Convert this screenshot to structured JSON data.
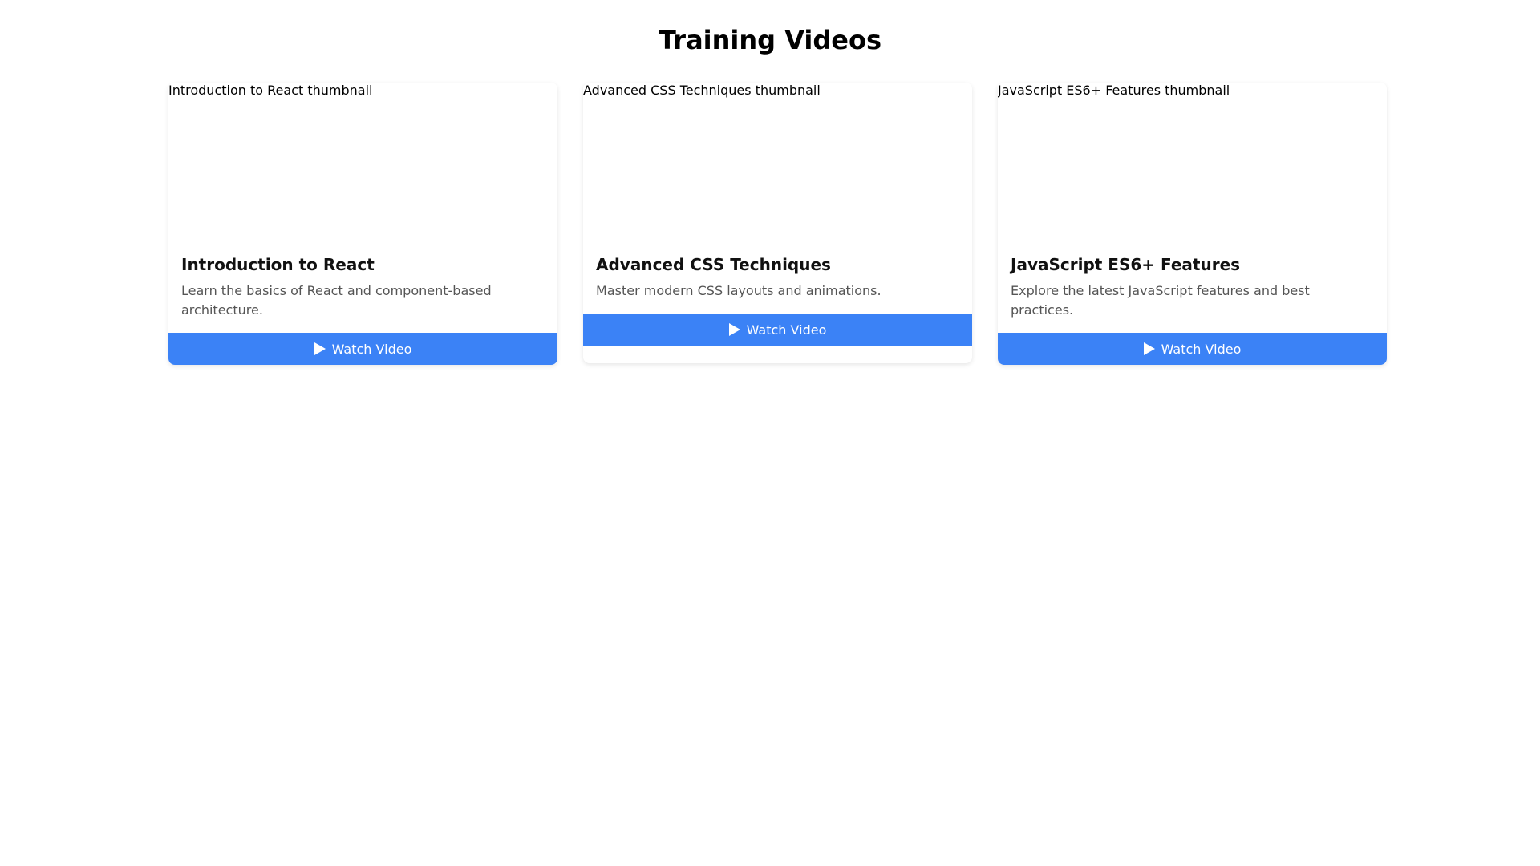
{
  "page": {
    "title": "Training Videos"
  },
  "colors": {
    "accent": "#3b82f6",
    "description_text": "#555555",
    "background": "#ffffff"
  },
  "videos": [
    {
      "thumbnail_alt": "Introduction to React thumbnail",
      "title": "Introduction to React",
      "description": "Learn the basics of React and component-based architecture.",
      "button_label": "Watch Video",
      "button_icon": "play-icon"
    },
    {
      "thumbnail_alt": "Advanced CSS Techniques thumbnail",
      "title": "Advanced CSS Techniques",
      "description": "Master modern CSS layouts and animations.",
      "button_label": "Watch Video",
      "button_icon": "play-icon"
    },
    {
      "thumbnail_alt": "JavaScript ES6+ Features thumbnail",
      "title": "JavaScript ES6+ Features",
      "description": "Explore the latest JavaScript features and best practices.",
      "button_label": "Watch Video",
      "button_icon": "play-icon"
    }
  ]
}
